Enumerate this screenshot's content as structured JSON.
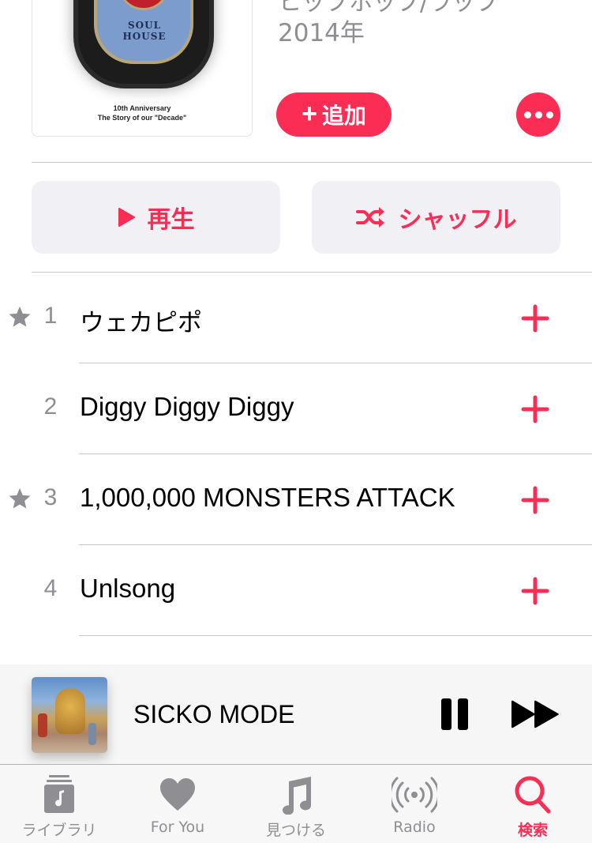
{
  "album": {
    "art_caption_line1": "10th Anniversary",
    "art_caption_line2": "The Story of our \"Decade\"",
    "art_badge_text": "SOUL HOUSE",
    "genre": "ヒップホップ/ラップ",
    "year": "2014年",
    "add_button": {
      "icon": "plus-icon",
      "label": "追加"
    },
    "more_button": {
      "icon": "ellipsis-icon"
    }
  },
  "actions": {
    "play": {
      "icon": "play-icon",
      "label": "再生"
    },
    "shuffle": {
      "icon": "shuffle-icon",
      "label": "シャッフル"
    }
  },
  "tracks": [
    {
      "number": "1",
      "title": "ウェカピポ",
      "starred": true,
      "add_icon": "plus-icon"
    },
    {
      "number": "2",
      "title": "Diggy Diggy Diggy",
      "starred": false,
      "add_icon": "plus-icon"
    },
    {
      "number": "3",
      "title": "1,000,000 MONSTERS ATTACK",
      "starred": true,
      "add_icon": "plus-icon"
    },
    {
      "number": "4",
      "title": "Unlsong",
      "starred": false,
      "add_icon": "plus-icon"
    }
  ],
  "now_playing": {
    "title": "SICKO MODE",
    "controls": [
      "pause-icon",
      "fast-forward-icon"
    ]
  },
  "tab_bar": {
    "tabs": [
      {
        "label": "ライブラリ",
        "icon": "library-icon",
        "active": false
      },
      {
        "label": "For You",
        "icon": "heart-icon",
        "active": false
      },
      {
        "label": "見つける",
        "icon": "music-note-icon",
        "active": false
      },
      {
        "label": "Radio",
        "icon": "radio-icon",
        "active": false
      },
      {
        "label": "検索",
        "icon": "search-icon",
        "active": true
      }
    ]
  },
  "colors": {
    "accent": "#fc2d55",
    "secondary_text": "#8e8e93",
    "button_bg": "#f1f1f5",
    "separator": "#c8c7cc"
  }
}
